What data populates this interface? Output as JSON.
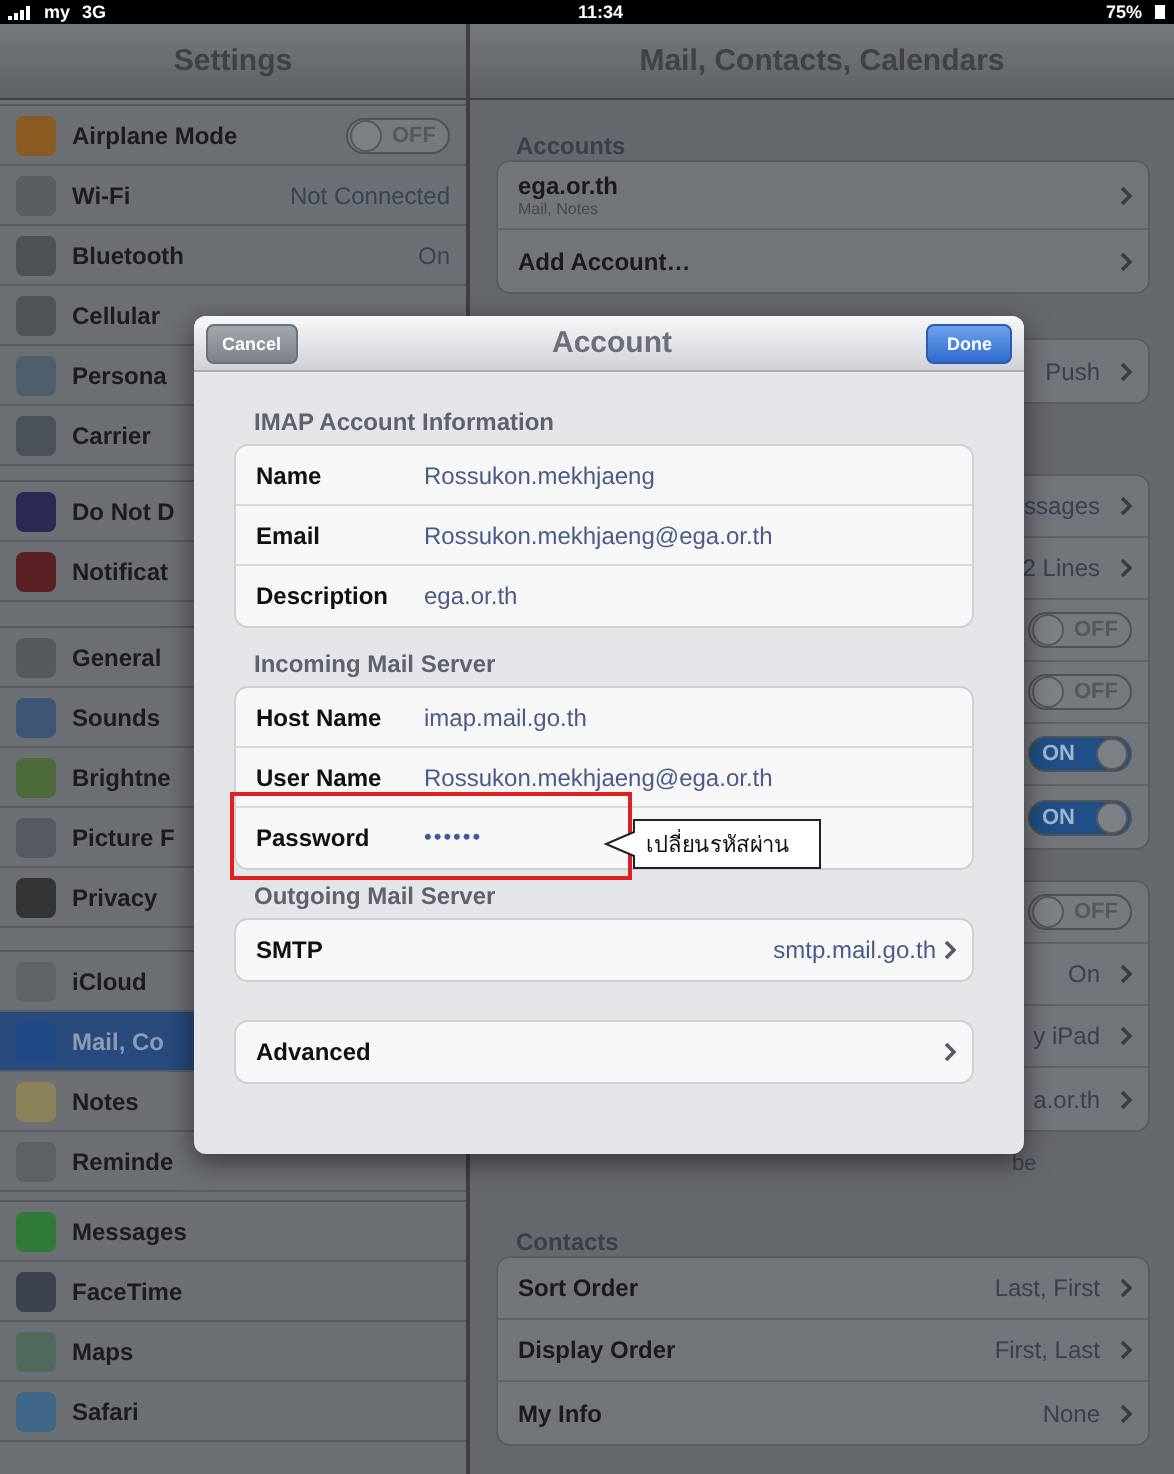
{
  "status_bar": {
    "carrier": "my",
    "network": "3G",
    "time": "11:34",
    "battery": "75%"
  },
  "sidebar": {
    "title": "Settings",
    "groups": [
      {
        "items": [
          {
            "label": "Airplane Mode",
            "kind": "toggle",
            "on": false,
            "toggle_label": "OFF",
            "selected": false
          },
          {
            "label": "Wi-Fi",
            "kind": "value",
            "value": "Not Connected",
            "selected": false
          },
          {
            "label": "Bluetooth",
            "kind": "value",
            "value": "On",
            "selected": false
          },
          {
            "label": "Cellular",
            "kind": "plain",
            "selected": false
          },
          {
            "label": "Persona",
            "kind": "plain",
            "selected": false
          },
          {
            "label": "Carrier",
            "kind": "plain",
            "selected": false
          }
        ]
      },
      {
        "items": [
          {
            "label": "Do Not D",
            "kind": "plain",
            "selected": false
          },
          {
            "label": "Notificat",
            "kind": "plain",
            "selected": false
          }
        ]
      },
      {
        "items": [
          {
            "label": "General",
            "kind": "plain",
            "selected": false
          },
          {
            "label": "Sounds",
            "kind": "plain",
            "selected": false
          },
          {
            "label": "Brightne",
            "kind": "plain",
            "selected": false
          },
          {
            "label": "Picture F",
            "kind": "plain",
            "selected": false
          },
          {
            "label": "Privacy",
            "kind": "plain",
            "selected": false
          }
        ]
      },
      {
        "items": [
          {
            "label": "iCloud",
            "kind": "plain",
            "selected": false
          },
          {
            "label": "Mail, Co",
            "kind": "plain",
            "selected": true
          },
          {
            "label": "Notes",
            "kind": "plain",
            "selected": false
          },
          {
            "label": "Reminde",
            "kind": "plain",
            "selected": false
          }
        ]
      },
      {
        "items": [
          {
            "label": "Messages",
            "kind": "plain",
            "selected": false
          },
          {
            "label": "FaceTime",
            "kind": "plain",
            "selected": false
          },
          {
            "label": "Maps",
            "kind": "plain",
            "selected": false
          },
          {
            "label": "Safari",
            "kind": "plain",
            "selected": false
          }
        ]
      }
    ]
  },
  "detail": {
    "title": "Mail, Contacts, Calendars",
    "sections": [
      {
        "header": "Accounts",
        "rows": [
          {
            "kind": "account",
            "label": "ega.or.th",
            "sublabel": "Mail, Notes",
            "chevron": true
          },
          {
            "kind": "value",
            "label": "Add Account…",
            "chevron": true
          }
        ]
      },
      {
        "rows": [
          {
            "kind": "value",
            "value": "Push",
            "chevron": true
          }
        ]
      },
      {
        "rows": [
          {
            "kind": "value",
            "value": "ssages",
            "chevron": true
          },
          {
            "kind": "value",
            "value": "2 Lines",
            "chevron": true
          },
          {
            "kind": "toggle",
            "on": false,
            "toggle_label": "OFF"
          },
          {
            "kind": "toggle",
            "on": false,
            "toggle_label": "OFF"
          },
          {
            "kind": "toggle",
            "on": true,
            "toggle_label": "ON"
          },
          {
            "kind": "toggle",
            "on": true,
            "toggle_label": "ON"
          }
        ]
      },
      {
        "rows": [
          {
            "kind": "toggle",
            "on": false,
            "toggle_label": "OFF"
          },
          {
            "kind": "value",
            "value": "On",
            "chevron": true
          },
          {
            "kind": "value",
            "value": "y iPad",
            "chevron": true
          },
          {
            "kind": "value",
            "value": "a.or.th",
            "chevron": true
          }
        ],
        "footer": "be"
      },
      {
        "header": "Contacts",
        "rows": [
          {
            "kind": "value",
            "label": "Sort Order",
            "value": "Last, First",
            "chevron": true
          },
          {
            "kind": "value",
            "label": "Display Order",
            "value": "First, Last",
            "chevron": true
          },
          {
            "kind": "value",
            "label": "My Info",
            "value": "None",
            "chevron": true
          }
        ]
      }
    ]
  },
  "dialog": {
    "title": "Account",
    "cancel": "Cancel",
    "done": "Done",
    "sections": [
      {
        "header": "IMAP Account Information",
        "rows": [
          {
            "kind": "field",
            "label": "Name",
            "value": "Rossukon.mekhjaeng"
          },
          {
            "kind": "field",
            "label": "Email",
            "value": "Rossukon.mekhjaeng@ega.or.th"
          },
          {
            "kind": "field",
            "label": "Description",
            "value": "ega.or.th"
          }
        ]
      },
      {
        "header": "Incoming Mail Server",
        "rows": [
          {
            "kind": "field",
            "label": "Host Name",
            "value": "imap.mail.go.th"
          },
          {
            "kind": "field",
            "label": "User Name",
            "value": "Rossukon.mekhjaeng@ega.or.th"
          },
          {
            "kind": "password",
            "label": "Password",
            "value": "••••••",
            "highlighted": true,
            "callout": "เปลี่ยนรหัสผ่าน"
          }
        ]
      },
      {
        "header": "Outgoing Mail Server",
        "rows": [
          {
            "kind": "link",
            "label": "SMTP",
            "value": "smtp.mail.go.th",
            "chevron": true
          }
        ]
      },
      {
        "rows": [
          {
            "kind": "link",
            "label": "Advanced",
            "chevron": true
          }
        ]
      }
    ]
  }
}
